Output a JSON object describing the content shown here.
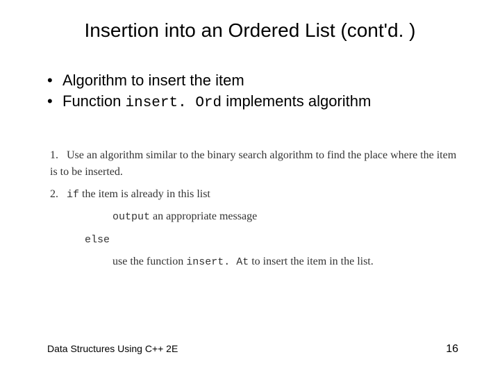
{
  "title": "Insertion into an Ordered List (cont'd. )",
  "bullets": {
    "b1": "Algorithm to insert the item",
    "b2_prefix": "Function ",
    "b2_code": "insert. Ord",
    "b2_suffix": " implements algorithm"
  },
  "algorithm": {
    "step1_num": "1.",
    "step1_text": "Use an algorithm similar to the binary search algorithm to find the place where the item is to be inserted.",
    "step2_num": "2.",
    "step2_if": "if",
    "step2_cond": " the item is already in this list",
    "step2_then": "output",
    "step2_then_rest": " an appropriate message",
    "step2_else": "else",
    "step2_else_body_pre": "use the function ",
    "step2_else_body_code": "insert. At",
    "step2_else_body_post": " to insert the item in the list."
  },
  "footer": {
    "left": "Data Structures Using C++ 2E",
    "right": "16"
  }
}
